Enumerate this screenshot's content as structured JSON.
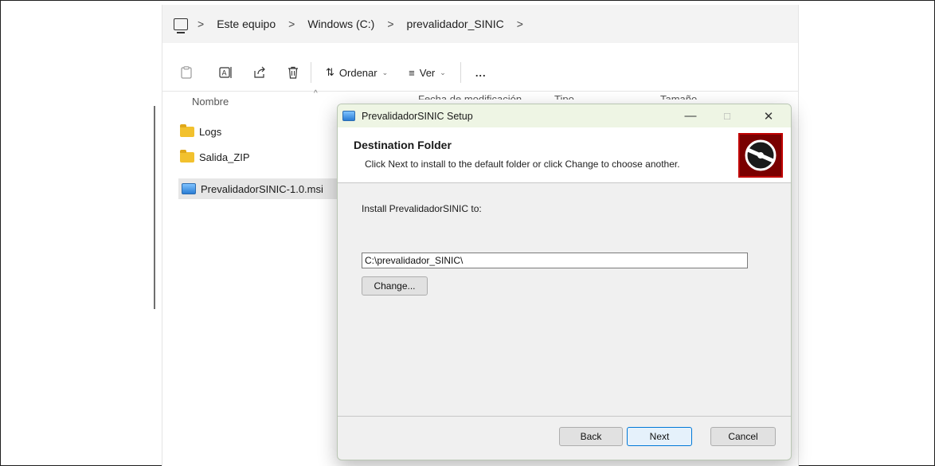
{
  "explorer": {
    "breadcrumbs": [
      "Este equipo",
      "Windows (C:)",
      "prevalidador_SINIC"
    ],
    "breadcrumb_sep": ">",
    "toolbar": {
      "sort_label": "Ordenar",
      "view_label": "Ver",
      "more_label": "..."
    },
    "columns": {
      "name": "Nombre",
      "date": "Fecha de modificación",
      "type": "Tipo",
      "size": "Tamaño"
    },
    "files": [
      {
        "name": "Logs",
        "icon": "folder-icon"
      },
      {
        "name": "Salida_ZIP",
        "icon": "folder-icon"
      },
      {
        "name": "PrevalidadorSINIC-1.0.msi",
        "icon": "msi-installer-icon"
      }
    ]
  },
  "dialog": {
    "title": "PrevalidadorSINIC Setup",
    "minimize": "—",
    "maximize": "□",
    "close": "✕",
    "heading": "Destination Folder",
    "subheading": "Click Next to install to the default folder or click Change to choose another.",
    "install_label": "Install PrevalidadorSINIC to:",
    "path_value": "C:\\prevalidador_SINIC\\",
    "change_label": "Change...",
    "back_label": "Back",
    "next_label": "Next",
    "cancel_label": "Cancel"
  }
}
